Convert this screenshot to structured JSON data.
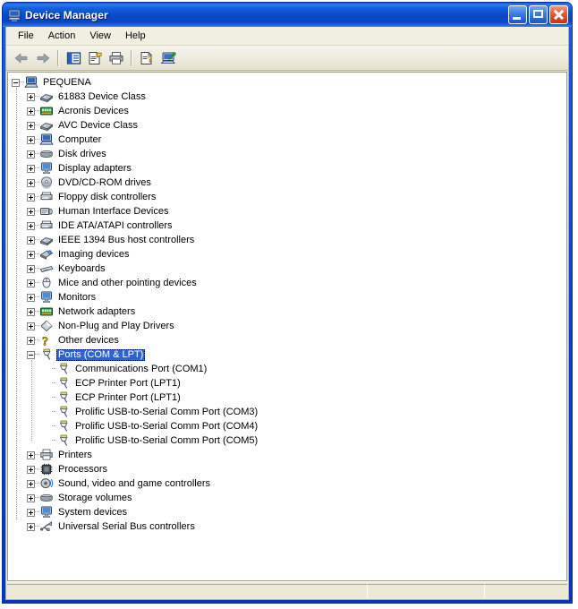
{
  "window": {
    "title": "Device Manager",
    "title_icon": "computer-icon",
    "caption_buttons": [
      {
        "name": "minimize-button",
        "label": "Minimize"
      },
      {
        "name": "maximize-button",
        "label": "Maximize"
      },
      {
        "name": "close-button",
        "label": "Close"
      }
    ],
    "colors": {
      "titlebar_blue": "#0a4ccb",
      "frame_blue": "#0b3fc0",
      "client_beige": "#ece9d8",
      "selection_blue": "#3163ce",
      "tree_background": "#ffffff"
    }
  },
  "menubar": {
    "items": [
      {
        "label": "File",
        "name": "menu-file"
      },
      {
        "label": "Action",
        "name": "menu-action"
      },
      {
        "label": "View",
        "name": "menu-view"
      },
      {
        "label": "Help",
        "name": "menu-help"
      }
    ]
  },
  "toolbar": {
    "buttons": [
      {
        "name": "back-button",
        "icon": "left-arrow-icon",
        "tooltip": "Back"
      },
      {
        "name": "forward-button",
        "icon": "right-arrow-icon",
        "tooltip": "Forward"
      },
      {
        "name": "separator-1",
        "icon": "separator"
      },
      {
        "name": "show-hide-tree-button",
        "icon": "console-tree-icon",
        "tooltip": "Show/Hide Console Tree"
      },
      {
        "name": "properties-button",
        "icon": "properties-icon",
        "tooltip": "Properties"
      },
      {
        "name": "print-button",
        "icon": "printer-icon",
        "tooltip": "Print"
      },
      {
        "name": "separator-2",
        "icon": "separator"
      },
      {
        "name": "help-button",
        "icon": "help-properties-icon",
        "tooltip": "Help"
      },
      {
        "name": "scan-hardware-button",
        "icon": "scan-hardware-icon",
        "tooltip": "Scan for hardware changes"
      }
    ]
  },
  "tree": {
    "root": {
      "label": "PEQUENA",
      "icon": "computer-icon",
      "expander": "minus",
      "level": 0,
      "selected": false
    },
    "items": [
      {
        "label": "61883 Device Class",
        "icon": "device-class-icon",
        "expander": "plus",
        "level": 1,
        "selected": false
      },
      {
        "label": "Acronis Devices",
        "icon": "board-icon",
        "expander": "plus",
        "level": 1,
        "selected": false
      },
      {
        "label": "AVC Device Class",
        "icon": "device-class-icon",
        "expander": "plus",
        "level": 1,
        "selected": false
      },
      {
        "label": "Computer",
        "icon": "computer-icon",
        "expander": "plus",
        "level": 1,
        "selected": false
      },
      {
        "label": "Disk drives",
        "icon": "disk-drive-icon",
        "expander": "plus",
        "level": 1,
        "selected": false
      },
      {
        "label": "Display adapters",
        "icon": "monitor-icon",
        "expander": "plus",
        "level": 1,
        "selected": false
      },
      {
        "label": "DVD/CD-ROM drives",
        "icon": "cdrom-icon",
        "expander": "plus",
        "level": 1,
        "selected": false
      },
      {
        "label": "Floppy disk controllers",
        "icon": "controller-icon",
        "expander": "plus",
        "level": 1,
        "selected": false
      },
      {
        "label": "Human Interface Devices",
        "icon": "hid-icon",
        "expander": "plus",
        "level": 1,
        "selected": false
      },
      {
        "label": "IDE ATA/ATAPI controllers",
        "icon": "controller-icon",
        "expander": "plus",
        "level": 1,
        "selected": false
      },
      {
        "label": "IEEE 1394 Bus host controllers",
        "icon": "device-class-icon",
        "expander": "plus",
        "level": 1,
        "selected": false
      },
      {
        "label": "Imaging devices",
        "icon": "imaging-icon",
        "expander": "plus",
        "level": 1,
        "selected": false
      },
      {
        "label": "Keyboards",
        "icon": "keyboard-icon",
        "expander": "plus",
        "level": 1,
        "selected": false
      },
      {
        "label": "Mice and other pointing devices",
        "icon": "mouse-icon",
        "expander": "plus",
        "level": 1,
        "selected": false
      },
      {
        "label": "Monitors",
        "icon": "monitor-icon",
        "expander": "plus",
        "level": 1,
        "selected": false
      },
      {
        "label": "Network adapters",
        "icon": "board-icon",
        "expander": "plus",
        "level": 1,
        "selected": false
      },
      {
        "label": "Non-Plug and Play Drivers",
        "icon": "diamond-icon",
        "expander": "plus",
        "level": 1,
        "selected": false
      },
      {
        "label": "Other devices",
        "icon": "question-mark-icon",
        "expander": "plus",
        "level": 1,
        "selected": false
      },
      {
        "label": "Ports (COM & LPT)",
        "icon": "port-icon",
        "expander": "minus",
        "level": 1,
        "selected": true
      },
      {
        "label": "Communications Port (COM1)",
        "icon": "port-icon",
        "expander": "none",
        "level": 2,
        "selected": false
      },
      {
        "label": "ECP Printer Port (LPT1)",
        "icon": "port-icon",
        "expander": "none",
        "level": 2,
        "selected": false
      },
      {
        "label": "ECP Printer Port (LPT1)",
        "icon": "port-icon",
        "expander": "none",
        "level": 2,
        "selected": false
      },
      {
        "label": "Prolific USB-to-Serial Comm Port (COM3)",
        "icon": "port-icon",
        "expander": "none",
        "level": 2,
        "selected": false
      },
      {
        "label": "Prolific USB-to-Serial Comm Port (COM4)",
        "icon": "port-icon",
        "expander": "none",
        "level": 2,
        "selected": false
      },
      {
        "label": "Prolific USB-to-Serial Comm Port (COM5)",
        "icon": "port-icon",
        "expander": "none",
        "level": 2,
        "selected": false
      },
      {
        "label": "Printers",
        "icon": "printer-icon",
        "expander": "plus",
        "level": 1,
        "selected": false
      },
      {
        "label": "Processors",
        "icon": "processor-icon",
        "expander": "plus",
        "level": 1,
        "selected": false
      },
      {
        "label": "Sound, video and game controllers",
        "icon": "speaker-icon",
        "expander": "plus",
        "level": 1,
        "selected": false
      },
      {
        "label": "Storage volumes",
        "icon": "disk-drive-icon",
        "expander": "plus",
        "level": 1,
        "selected": false
      },
      {
        "label": "System devices",
        "icon": "monitor-icon",
        "expander": "plus",
        "level": 1,
        "selected": false
      },
      {
        "label": "Universal Serial Bus controllers",
        "icon": "usb-icon",
        "expander": "plus",
        "level": 1,
        "selected": false
      }
    ]
  },
  "statusbar": {
    "panes": [
      "",
      "",
      ""
    ]
  }
}
